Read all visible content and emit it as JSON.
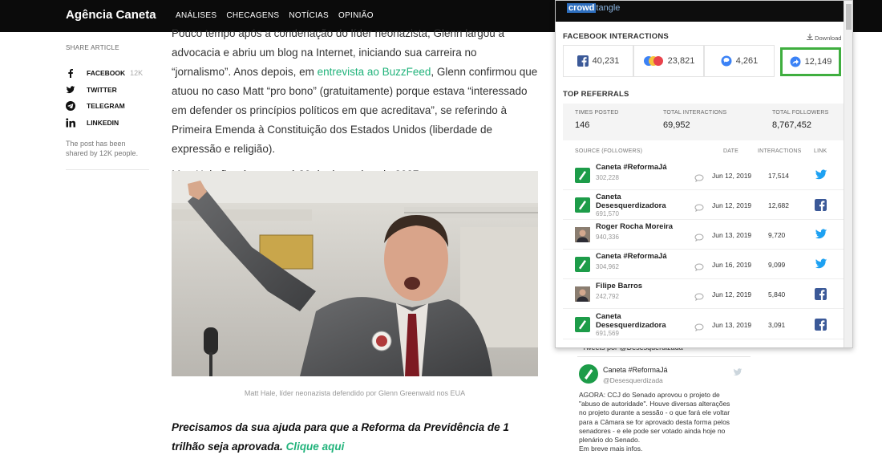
{
  "header": {
    "brand": "Agência Caneta",
    "nav": [
      "ANÁLISES",
      "CHECAGENS",
      "NOTÍCIAS",
      "OPINIÃO"
    ]
  },
  "share": {
    "heading": "SHARE ARTICLE",
    "items": [
      {
        "label": "FACEBOOK",
        "count": "12K",
        "icon": "facebook-icon"
      },
      {
        "label": "TWITTER",
        "icon": "twitter-icon"
      },
      {
        "label": "TELEGRAM",
        "icon": "telegram-icon"
      },
      {
        "label": "LINKEDIN",
        "icon": "linkedin-icon"
      }
    ],
    "note": "The post has been shared by 12K people."
  },
  "article": {
    "p1_a": "Pouco tempo após a condenação do líder neonazista, Glenn largou a advocacia e abriu um blog na Internet, iniciando sua carreira no “jornalismo”. Anos depois, em ",
    "p1_link": "entrevista ao BuzzFeed",
    "p1_b": ", Glenn confirmou que atuou no caso Matt “pro bono” (gratuitamente) porque estava “interessado em defender os princípios políticos em que acreditava”, se referindo à Primeira Emenda à Constituição dos Estados Unidos (liberdade de expressão e religião).",
    "p2": "Matt Hale ficará preso até 30 de dezembro de 2037.",
    "caption": "Matt Hale, líder neonazista defendido por Glenn Greenwald nos EUA",
    "cta_text": "Precisamos da sua ajuda para que a Reforma da Previdência de 1 trilhão seja aprovada. ",
    "cta_link": "Clique aqui"
  },
  "tweet": {
    "header": "Tweets por @Desesquerdizada",
    "name": "Caneta #ReformaJá",
    "handle": "@Desesquerdizada",
    "text": "AGORA: CCJ do Senado aprovou o projeto de \"abuso de autoridade\". Houve diversas alterações no projeto durante a sessão - o que fará ele voltar para a Câmara se for aprovado desta forma pelos senadores - e ele pode ser votado ainda hoje no plenário do Senado.\nEm breve mais infos."
  },
  "crowdtangle": {
    "logo_a": "crowd",
    "logo_b": "tangle",
    "fb_title": "FACEBOOK INTERACTIONS",
    "download": "Download",
    "interactions": [
      {
        "icon": "facebook-icon",
        "value": "40,231"
      },
      {
        "icon": "reactions-icon",
        "value": "23,821"
      },
      {
        "icon": "comment-icon",
        "value": "4,261"
      },
      {
        "icon": "share-icon",
        "value": "12,149",
        "highlighted": true
      }
    ],
    "ref_title": "TOP REFERRALS",
    "summary": {
      "times_posted_label": "TIMES POSTED",
      "times_posted": "146",
      "total_interactions_label": "TOTAL INTERACTIONS",
      "total_interactions": "69,952",
      "total_followers_label": "TOTAL FOLLOWERS",
      "total_followers": "8,767,452"
    },
    "columns": {
      "source": "SOURCE (FOLLOWERS)",
      "date": "DATE",
      "interactions": "INTERACTIONS",
      "link": "LINK"
    },
    "rows": [
      {
        "name": "Caneta #ReformaJá",
        "followers": "302,228",
        "date": "Jun 12, 2019",
        "interactions": "17,514",
        "platform": "twitter",
        "avatar": "green"
      },
      {
        "name": "Caneta Desesquerdizadora",
        "followers": "691,570",
        "date": "Jun 12, 2019",
        "interactions": "12,682",
        "platform": "facebook",
        "avatar": "green"
      },
      {
        "name": "Roger Rocha Moreira",
        "followers": "940,336",
        "date": "Jun 13, 2019",
        "interactions": "9,720",
        "platform": "twitter",
        "avatar": "person"
      },
      {
        "name": "Caneta #ReformaJá",
        "followers": "304,962",
        "date": "Jun 16, 2019",
        "interactions": "9,099",
        "platform": "twitter",
        "avatar": "green"
      },
      {
        "name": "Filipe Barros",
        "followers": "242,792",
        "date": "Jun 12, 2019",
        "interactions": "5,840",
        "platform": "facebook",
        "avatar": "person"
      },
      {
        "name": "Caneta Desesquerdizadora",
        "followers": "691,569",
        "date": "Jun 13, 2019",
        "interactions": "3,091",
        "platform": "facebook",
        "avatar": "green"
      }
    ]
  },
  "colors": {
    "accent": "#21b37b",
    "highlight": "#3fae3f",
    "facebook": "#3b5998",
    "twitter": "#1da1f2"
  }
}
